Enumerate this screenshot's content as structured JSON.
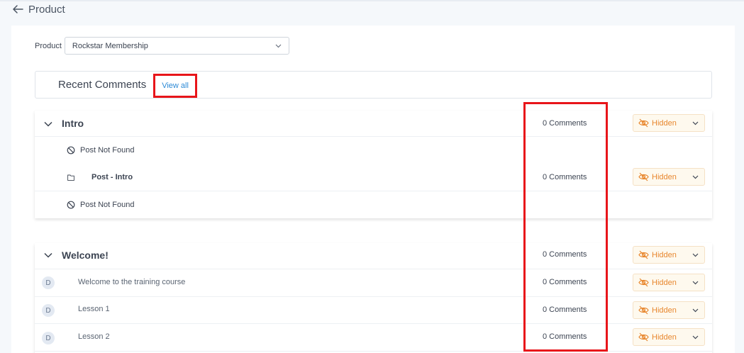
{
  "header": {
    "title": "Product",
    "back_icon": "arrow-left-icon"
  },
  "product_selector": {
    "label": "Product",
    "value": "Rockstar Membership"
  },
  "recent_comments": {
    "title": "Recent Comments",
    "view_all_label": "View all"
  },
  "sections": [
    {
      "title": "Intro",
      "comments": "0 Comments",
      "visibility": "Hidden",
      "items": [
        {
          "type": "not_found",
          "label": "Post Not Found"
        },
        {
          "type": "post",
          "label": "Post - Intro",
          "comments": "0 Comments",
          "visibility": "Hidden"
        },
        {
          "type": "not_found",
          "label": "Post Not Found"
        }
      ]
    },
    {
      "title": "Welcome!",
      "comments": "0 Comments",
      "visibility": "Hidden",
      "items": [
        {
          "type": "lesson",
          "avatar": "D",
          "label": "Welcome to the training course",
          "comments": "0 Comments",
          "visibility": "Hidden"
        },
        {
          "type": "lesson",
          "avatar": "D",
          "label": "Lesson 1",
          "comments": "0 Comments",
          "visibility": "Hidden"
        },
        {
          "type": "lesson",
          "avatar": "D",
          "label": "Lesson 2",
          "comments": "0 Comments",
          "visibility": "Hidden"
        }
      ]
    }
  ],
  "colors": {
    "accent_link": "#2d8ad6",
    "hidden_text": "#e8872e",
    "hidden_bg": "#fef9ee",
    "highlight_red": "#e8151a"
  }
}
